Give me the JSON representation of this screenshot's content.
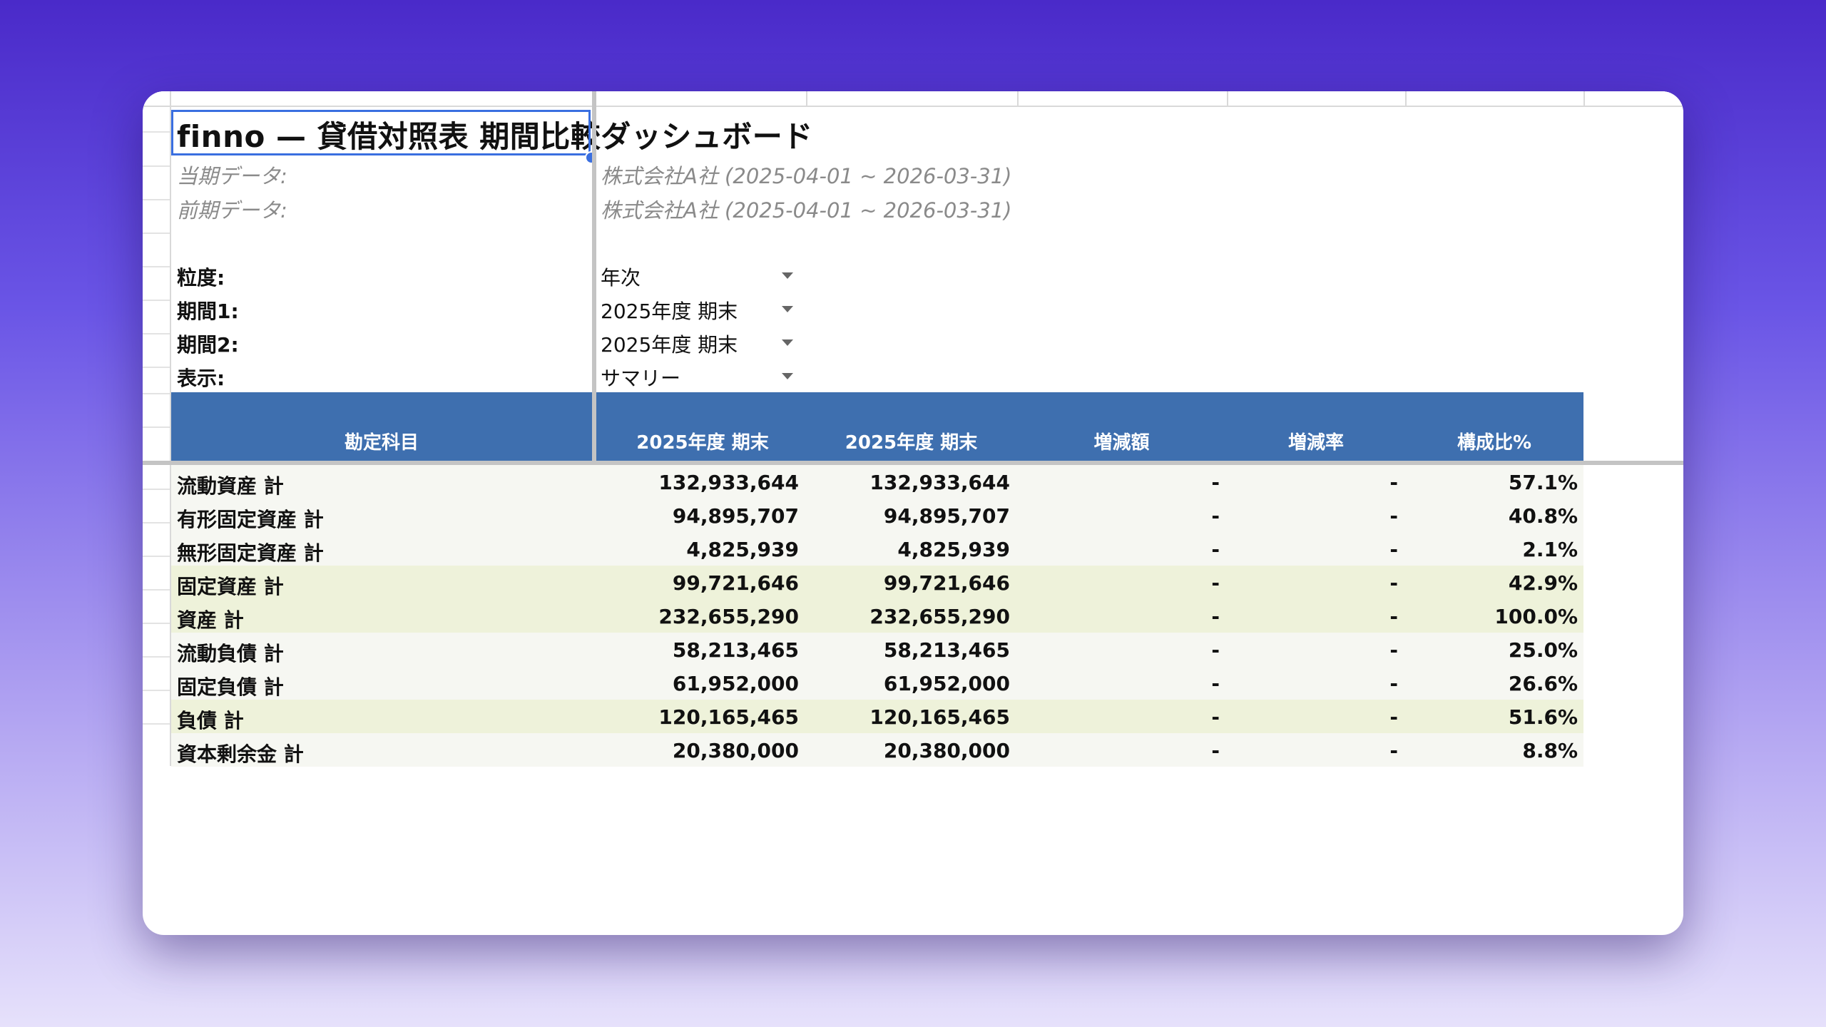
{
  "sheet": {
    "title": "finno — 貸借対照表 期間比較ダッシュボード",
    "current_label": "当期データ:",
    "current_value": "株式会社A社 (2025-04-01 ~ 2026-03-31)",
    "prior_label": "前期データ:",
    "prior_value": "株式会社A社 (2025-04-01 ~ 2026-03-31)",
    "controls": [
      {
        "label": "粒度:",
        "value": "年次"
      },
      {
        "label": "期間1:",
        "value": "2025年度 期末"
      },
      {
        "label": "期間2:",
        "value": "2025年度 期末"
      },
      {
        "label": "表示:",
        "value": "サマリー"
      }
    ]
  },
  "table": {
    "headers": [
      "勘定科目",
      "2025年度 期末",
      "2025年度 期末",
      "増減額",
      "増減率",
      "構成比%"
    ],
    "rows": [
      {
        "name": "流動資産 計",
        "p1": "132,933,644",
        "p2": "132,933,644",
        "diff": "-",
        "rate": "-",
        "ratio": "57.1%",
        "highlight": false
      },
      {
        "name": "有形固定資産 計",
        "p1": "94,895,707",
        "p2": "94,895,707",
        "diff": "-",
        "rate": "-",
        "ratio": "40.8%",
        "highlight": false
      },
      {
        "name": "無形固定資産 計",
        "p1": "4,825,939",
        "p2": "4,825,939",
        "diff": "-",
        "rate": "-",
        "ratio": "2.1%",
        "highlight": false
      },
      {
        "name": "固定資産 計",
        "p1": "99,721,646",
        "p2": "99,721,646",
        "diff": "-",
        "rate": "-",
        "ratio": "42.9%",
        "highlight": true
      },
      {
        "name": "資産 計",
        "p1": "232,655,290",
        "p2": "232,655,290",
        "diff": "-",
        "rate": "-",
        "ratio": "100.0%",
        "highlight": true
      },
      {
        "name": "流動負債 計",
        "p1": "58,213,465",
        "p2": "58,213,465",
        "diff": "-",
        "rate": "-",
        "ratio": "25.0%",
        "highlight": false
      },
      {
        "name": "固定負債 計",
        "p1": "61,952,000",
        "p2": "61,952,000",
        "diff": "-",
        "rate": "-",
        "ratio": "26.6%",
        "highlight": false
      },
      {
        "name": "負債 計",
        "p1": "120,165,465",
        "p2": "120,165,465",
        "diff": "-",
        "rate": "-",
        "ratio": "51.6%",
        "highlight": true
      },
      {
        "name": "資本剰余金 計",
        "p1": "20,380,000",
        "p2": "20,380,000",
        "diff": "-",
        "rate": "-",
        "ratio": "8.8%",
        "highlight": false
      }
    ]
  },
  "colors": {
    "header_bg": "#3e6faf",
    "row_plain": "#f6f7f2",
    "row_highlight": "#eef2da",
    "selection": "#3a6fe0"
  }
}
